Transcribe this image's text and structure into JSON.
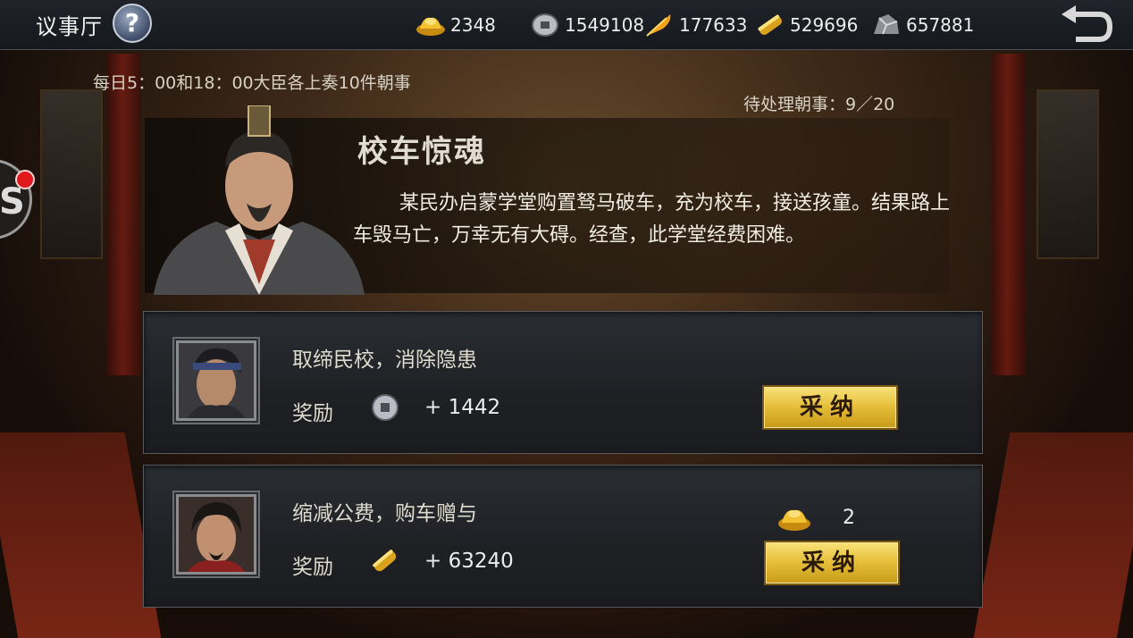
{
  "header": {
    "title": "议事厅",
    "help_label": "?",
    "resources": [
      {
        "icon": "gold-ingot-icon",
        "value": "2348"
      },
      {
        "icon": "silver-coin-icon",
        "value": "1549108"
      },
      {
        "icon": "feather-icon",
        "value": "177633"
      },
      {
        "icon": "grain-bar-icon",
        "value": "529696"
      },
      {
        "icon": "iron-ore-icon",
        "value": "657881"
      }
    ]
  },
  "info": {
    "daily_note": "每日5：00和18：00大臣各上奏10件朝事",
    "pending": "待处理朝事：9／20"
  },
  "event": {
    "title": "校车惊魂",
    "description": "某民办启蒙学堂购置驽马破车，充为校车，接送孩童。结果路上车毁马亡，万幸无有大碍。经查，此学堂经费困难。"
  },
  "options": [
    {
      "text": "取缔民校，消除隐患",
      "reward_label": "奖励",
      "reward_icon": "silver-coin-icon",
      "reward_value": "+ 1442",
      "button_label": "采纳"
    },
    {
      "text": "缩减公费，购车赠与",
      "reward_label": "奖励",
      "reward_icon": "grain-bar-icon",
      "reward_value": "+ 63240",
      "cost_icon": "gold-ingot-icon",
      "cost_value": "2",
      "button_label": "采纳"
    }
  ],
  "colors": {
    "button_gold": "#e7c13c",
    "notification_red": "#e2191c"
  }
}
